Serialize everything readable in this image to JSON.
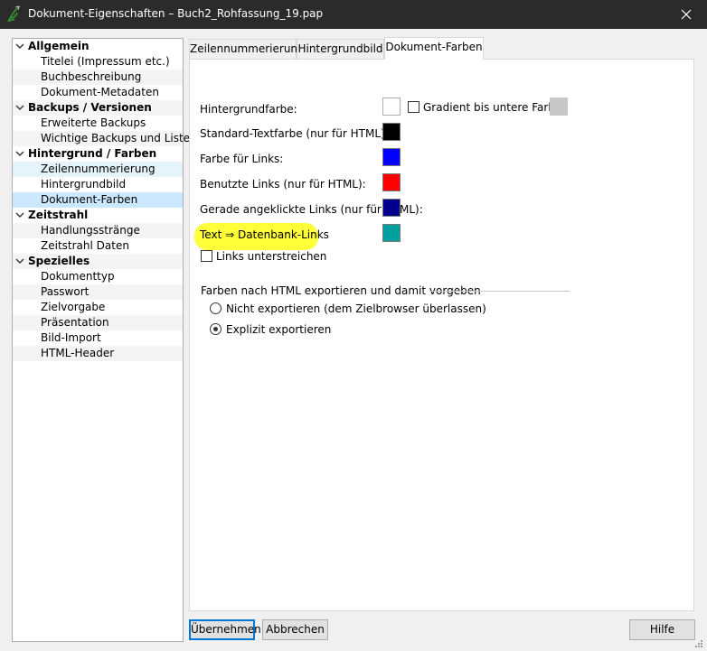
{
  "window": {
    "title": "Dokument-Eigenschaften – Buch2_Rohfassung_19.pap"
  },
  "tree": [
    {
      "label": "Allgemein",
      "type": "cat"
    },
    {
      "label": "Titelei (Impressum etc.)",
      "type": "item"
    },
    {
      "label": "Buchbeschreibung",
      "type": "item"
    },
    {
      "label": "Dokument-Metadaten",
      "type": "item"
    },
    {
      "label": "Backups / Versionen",
      "type": "cat"
    },
    {
      "label": "Erweiterte Backups",
      "type": "item"
    },
    {
      "label": "Wichtige Backups und Liste",
      "type": "item"
    },
    {
      "label": "Hintergrund / Farben",
      "type": "cat"
    },
    {
      "label": "Zeilennummerierung",
      "type": "item"
    },
    {
      "label": "Hintergrundbild",
      "type": "item"
    },
    {
      "label": "Dokument-Farben",
      "type": "item"
    },
    {
      "label": "Zeitstrahl",
      "type": "cat"
    },
    {
      "label": "Handlungsstränge",
      "type": "item"
    },
    {
      "label": "Zeitstrahl Daten",
      "type": "item"
    },
    {
      "label": "Spezielles",
      "type": "cat"
    },
    {
      "label": "Dokumenttyp",
      "type": "item"
    },
    {
      "label": "Passwort",
      "type": "item"
    },
    {
      "label": "Zielvorgabe",
      "type": "item"
    },
    {
      "label": "Präsentation",
      "type": "item"
    },
    {
      "label": "Bild-Import",
      "type": "item"
    },
    {
      "label": "HTML-Header",
      "type": "item"
    }
  ],
  "tabs": [
    {
      "label": "Zeilennummerierung"
    },
    {
      "label": "Hintergrundbild"
    },
    {
      "label": "Dokument-Farben"
    }
  ],
  "colors": {
    "hintergrund": "#ffffff",
    "gradient": "#c8c8c8",
    "standard_text": "#000000",
    "links": "#0000ff",
    "benutzte_links": "#ff0000",
    "angeklickte_links": "#00008b",
    "datenbank_links": "#00a0a0",
    "highlight": "#ffff3a"
  },
  "fields": {
    "hintergrundfarbe": "Hintergrundfarbe:",
    "gradient": "Gradient bis untere Farbe:",
    "standard_textfarbe": "Standard-Textfarbe (nur für HTML):",
    "farbe_links": "Farbe für Links:",
    "benutzte_links": "Benutzte Links (nur für HTML):",
    "angeklickte_links": "Gerade angeklickte Links (nur für HTML):",
    "datenbank_links": "Text ⇒ Datenbank-Links",
    "links_unterstreichen": "Links unterstreichen"
  },
  "export_group": {
    "title": "Farben nach HTML exportieren und damit vorgeben",
    "options": [
      {
        "label": "Nicht exportieren (dem Zielbrowser überlassen)",
        "selected": false
      },
      {
        "label": "Explizit exportieren",
        "selected": true
      }
    ]
  },
  "buttons": {
    "uebernehmen": "Übernehmen",
    "abbrechen": "Abbrechen",
    "hilfe": "Hilfe"
  }
}
